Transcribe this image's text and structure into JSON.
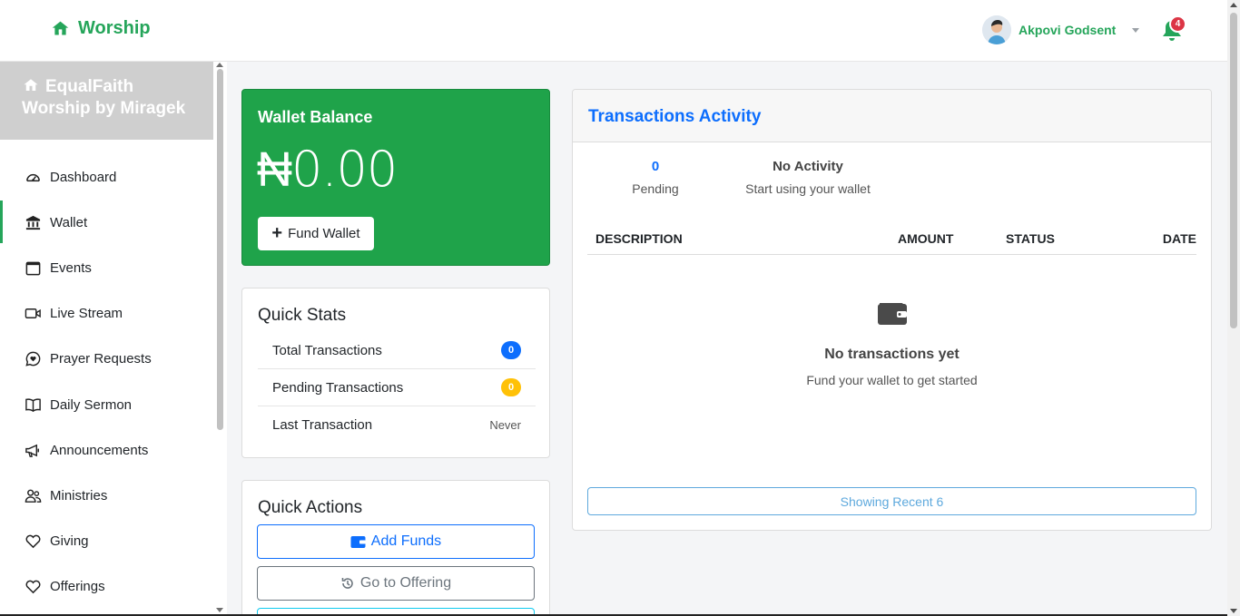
{
  "topbar": {
    "brand": "Worship",
    "user_name": "Akpovi Godsent",
    "notification_count": "4"
  },
  "sidebar": {
    "org_line1": "EqualFaith",
    "org_line2": "Worship by Miragek",
    "items": [
      {
        "label": "Dashboard",
        "icon": "dashboard-gauge-icon"
      },
      {
        "label": "Wallet",
        "icon": "bank-icon",
        "active": true
      },
      {
        "label": "Events",
        "icon": "calendar-icon"
      },
      {
        "label": "Live Stream",
        "icon": "video-camera-icon"
      },
      {
        "label": "Prayer Requests",
        "icon": "chat-heart-icon"
      },
      {
        "label": "Daily Sermon",
        "icon": "open-book-icon"
      },
      {
        "label": "Announcements",
        "icon": "megaphone-icon"
      },
      {
        "label": "Ministries",
        "icon": "people-icon"
      },
      {
        "label": "Giving",
        "icon": "heart-icon"
      },
      {
        "label": "Offerings",
        "icon": "heart-icon"
      }
    ]
  },
  "wallet": {
    "title": "Wallet Balance",
    "amount": "₦0.00",
    "fund_button": "Fund Wallet"
  },
  "quick_stats": {
    "title": "Quick Stats",
    "rows": [
      {
        "label": "Total Transactions",
        "value": "0"
      },
      {
        "label": "Pending Transactions",
        "value": "0"
      },
      {
        "label": "Last Transaction",
        "value": "Never"
      }
    ]
  },
  "quick_actions": {
    "title": "Quick Actions",
    "buttons": [
      "Add Funds",
      "Go to Offering"
    ]
  },
  "transactions": {
    "title": "Transactions Activity",
    "pending_value": "0",
    "pending_label": "Pending",
    "activity_value": "No Activity",
    "activity_label": "Start using your wallet",
    "columns": [
      "DESCRIPTION",
      "AMOUNT",
      "STATUS",
      "DATE"
    ],
    "empty_title": "No transactions yet",
    "empty_sub": "Fund your wallet to get started",
    "recent_button": "Showing Recent 6"
  },
  "colors": {
    "brand_green": "#25a55a",
    "wallet_green": "#1fa34a",
    "primary_blue": "#0d6efd",
    "warning_yellow": "#ffc107",
    "danger_red": "#dc3545"
  }
}
